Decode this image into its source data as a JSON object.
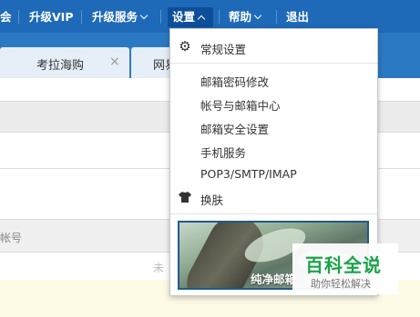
{
  "topbar": {
    "item_hui": "会",
    "item_upgrade_vip": "升级VIP",
    "item_upgrade_service": "升级服务",
    "item_settings": "设置",
    "item_help": "帮助",
    "item_logout": "退出",
    "background": "#1e6ab8"
  },
  "tabs": {
    "tab1_label": "考拉海购",
    "tab1_close": "×",
    "tab2_label": "网易"
  },
  "background_panel": {
    "account_label": "帐号",
    "unread_label": "未"
  },
  "settings_menu": {
    "items": [
      {
        "label": "常规设置",
        "icon": "gear-icon"
      },
      {
        "label": "邮箱密码修改"
      },
      {
        "label": "帐号与邮箱中心"
      },
      {
        "label": "邮箱安全设置"
      },
      {
        "label": "手机服务"
      },
      {
        "label": "POP3/SMTP/IMAP"
      },
      {
        "label": "换肤",
        "icon": "tshirt-icon"
      }
    ],
    "skin_banner_text": "纯净邮箱"
  },
  "watermark": {
    "main": "百科全说",
    "sub": "助你轻松解决"
  }
}
